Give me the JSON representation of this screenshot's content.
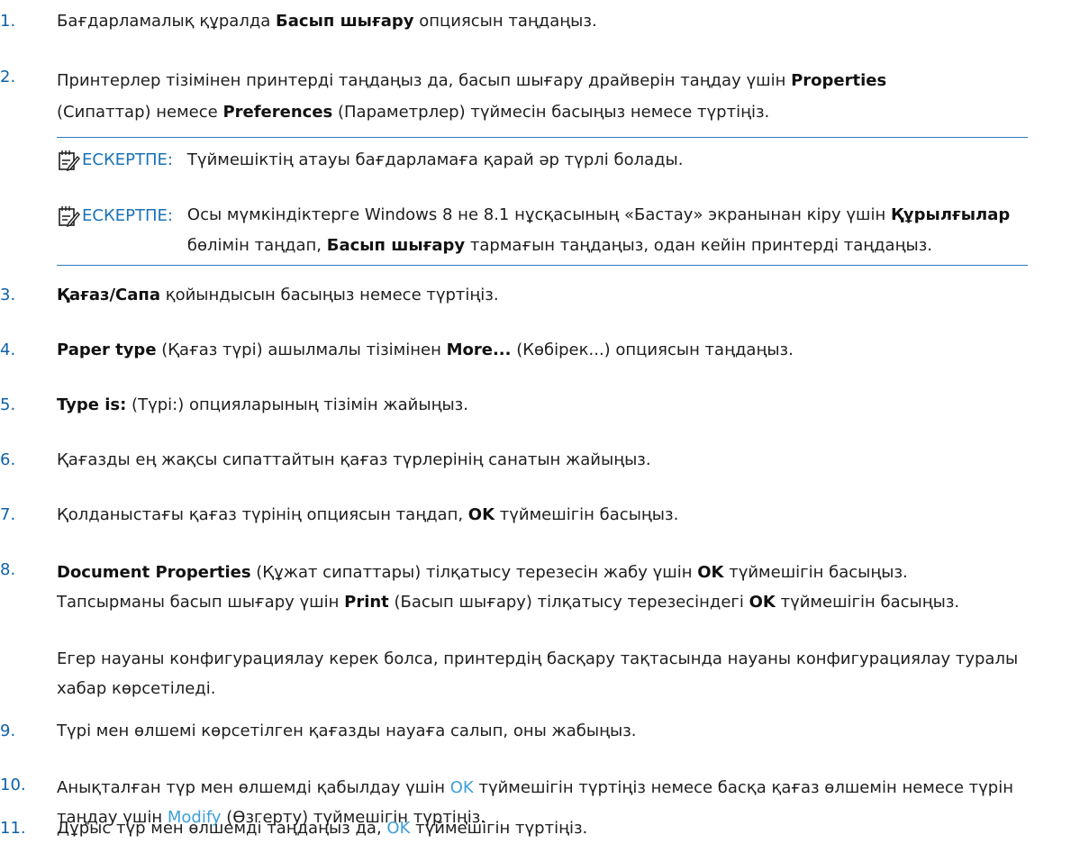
{
  "steps": {
    "s1": {
      "num": "1.",
      "a": "Бағдарламалық құралда ",
      "b1": "Басып шығару",
      "c": " опциясын таңдаңыз."
    },
    "s2": {
      "num": "2.",
      "a": "Принтерлер тізімінен принтерді таңдаңыз да, басып шығару драйверін таңдау үшін ",
      "b1": "Properties",
      "c": "(Сипаттар) немесе ",
      "b2": "Preferences",
      "d": " (Параметрлер) түймесін басыңыз немесе түртіңіз."
    },
    "s3": {
      "num": "3.",
      "b1": "Қағаз/Сапа",
      "c": " қойындысын басыңыз немесе түртіңіз."
    },
    "s4": {
      "num": "4.",
      "b1": "Paper type",
      "c": " (Қағаз түрі) ашылмалы тізімінен ",
      "b2": "More...",
      "d": " (Көбірек...) опциясын таңдаңыз."
    },
    "s5": {
      "num": "5.",
      "b1": "Type is:",
      "c": " (Түрі:) опцияларының тізімін жайыңыз."
    },
    "s6": {
      "num": "6.",
      "a": "Қағазды ең жақсы сипаттайтын қағаз түрлерінің санатын жайыңыз."
    },
    "s7": {
      "num": "7.",
      "a": "Қолданыстағы қағаз түрінің опциясын таңдап, ",
      "b1": "OK",
      "c": " түймешігін басыңыз."
    },
    "s8": {
      "num": "8.",
      "b1": "Document Properties",
      "c": " (Құжат сипаттары) тілқатысу терезесін жабу үшін ",
      "b2": "OK",
      "d": " түймешігін басыңыз.",
      "e": "Тапсырманы басып шығару үшін ",
      "b3": "Print",
      "f": " (Басып шығару) тілқатысу терезесіндегі ",
      "b4": "OK",
      "g": " түймешігін басыңыз.",
      "para": "Егер науаны конфигурациялау керек болса, принтердің басқару тақтасында науаны конфигурациялау туралы хабар көрсетіледі."
    },
    "s9": {
      "num": "9.",
      "a": "Түрі мен өлшемі көрсетілген қағазды науаға салып, оны жабыңыз."
    },
    "s10": {
      "num": "10.",
      "a": "Анықталған түр мен өлшемді қабылдау үшін ",
      "l1": "OK",
      "c": " түймешігін түртіңіз немесе басқа қағаз өлшемін немесе түрін таңдау үшін ",
      "l2": "Modify",
      "d": " (Өзгерту) түймешігін түртіңіз."
    },
    "s11": {
      "num": "11.",
      "a": "Дұрыс түр мен өлшемді таңдаңыз да, ",
      "l1": "OK",
      "c": " түймешігін түртіңіз."
    }
  },
  "notes": {
    "n1": {
      "label": "ЕСКЕРТПЕ:",
      "text": "Түймешіктің атауы бағдарламаға қарай әр түрлі болады."
    },
    "n2": {
      "label": "ЕСКЕРТПЕ:",
      "a": "Осы мүмкіндіктерге Windows 8 не 8.1 нұсқасының «Бастау» экранынан кіру үшін ",
      "b1": "Құрылғылар",
      "c": " бөлімін таңдап, ",
      "b2": "Басып шығару",
      "d": " тармағын таңдаңыз, одан кейін принтерді таңдаңыз."
    }
  },
  "colors": {
    "accent": "#0e62a8",
    "link": "#3e9fd8",
    "rule": "#2d7cc1"
  }
}
